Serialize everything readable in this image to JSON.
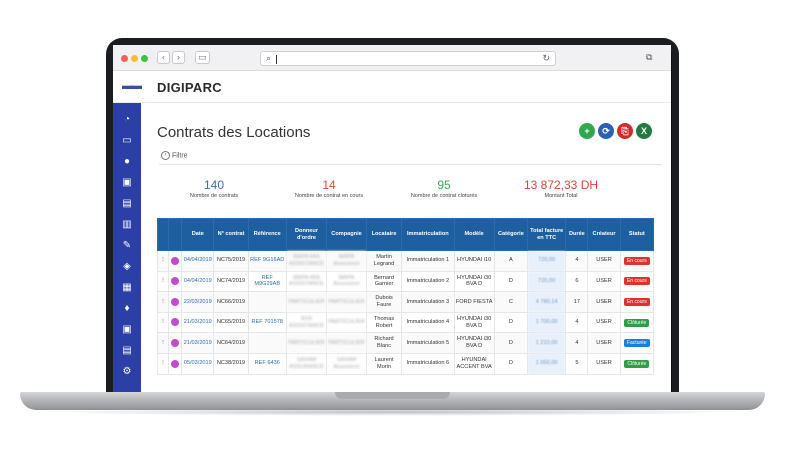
{
  "app": {
    "brand": "DIGIPARC"
  },
  "page": {
    "title": "Contrats des Locations",
    "filter_label": "Filtre"
  },
  "actions": [
    {
      "name": "add",
      "glyph": "+",
      "color": "#2fa84f"
    },
    {
      "name": "refresh",
      "glyph": "⟳",
      "color": "#2b5fb8"
    },
    {
      "name": "pdf",
      "glyph": "⎘",
      "color": "#d42a2a"
    },
    {
      "name": "excel",
      "glyph": "X",
      "color": "#1f7a43"
    }
  ],
  "stats": [
    {
      "value": "140",
      "label": "Nombre de contrats",
      "color": "#3b6fb8"
    },
    {
      "value": "14",
      "label": "Nombre de contrat en cours",
      "color": "#e0463a"
    },
    {
      "value": "95",
      "label": "Nombre de contrat cloturés",
      "color": "#36a852"
    },
    {
      "value": "13 872,33 DH",
      "label": "Montant Total",
      "color": "#e0463a"
    }
  ],
  "table": {
    "headers": [
      "",
      "",
      "Date",
      "N° contrat",
      "Référence",
      "Donneur d'ordre",
      "Compagnie",
      "Locataire",
      "Immatriculation",
      "Modèle",
      "Catégorie",
      "Total facture en TTC",
      "Durée",
      "Créateur",
      "Statut"
    ],
    "rows": [
      {
        "date": "04/04/2019",
        "num": "NC75/2019",
        "ref": "REF 9G16AD",
        "donneur": "MAPA MIA ASSISTANCE",
        "compagnie": "MAPA Assurance",
        "locataire": "Martin Legrand",
        "immat": "Immatriculation 1",
        "modele": "HYUNDAI i10",
        "cat": "A",
        "total": "720,00",
        "duree": "4",
        "createur": "USER",
        "statut": "En cours",
        "statut_color": "#e03131"
      },
      {
        "date": "04/04/2019",
        "num": "NC74/2019",
        "ref": "REF M9G29AB",
        "donneur": "MAPA MIA ASSISTANCE",
        "compagnie": "MAPA Assurance",
        "locataire": "Bernard Garnier",
        "immat": "Immatriculation 2",
        "modele": "HYUNDAI i30 BVA D",
        "cat": "D",
        "total": "720,00",
        "duree": "6",
        "createur": "USER",
        "statut": "En cours",
        "statut_color": "#e03131"
      },
      {
        "date": "22/03/2019",
        "num": "NC66/2019",
        "ref": "",
        "donneur": "PARTICULIER",
        "compagnie": "PARTICULIER",
        "locataire": "Dubois Faure",
        "immat": "Immatriculation 3",
        "modele": "FORD FIESTA",
        "cat": "C",
        "total": "4 780,14",
        "duree": "17",
        "createur": "USER",
        "statut": "En cours",
        "statut_color": "#e03131"
      },
      {
        "date": "21/03/2019",
        "num": "NC65/2019",
        "ref": "REF 701578",
        "donneur": "AXA ASSISTANCE",
        "compagnie": "PARTICULIER",
        "locataire": "Thomas Robert",
        "immat": "Immatriculation 4",
        "modele": "HYUNDAI i30 BVA D",
        "cat": "D",
        "total": "1 700,00",
        "duree": "4",
        "createur": "USER",
        "statut": "Clôturée",
        "statut_color": "#2f9e44"
      },
      {
        "date": "21/03/2019",
        "num": "NC64/2019",
        "ref": "",
        "donneur": "PARTICULIER",
        "compagnie": "PARTICULIER",
        "locataire": "Richard Blanc",
        "immat": "Immatriculation 5",
        "modele": "HYUNDAI i30 BVA D",
        "cat": "D",
        "total": "1 210,00",
        "duree": "4",
        "createur": "USER",
        "statut": "Facturée",
        "statut_color": "#1c7ed6"
      },
      {
        "date": "05/03/2019",
        "num": "NC38/2019",
        "ref": "REF 6436",
        "donneur": "SAHAM ASSURANCE",
        "compagnie": "SAHAM Assurance",
        "locataire": "Laurent Morin",
        "immat": "Immatriculation 6",
        "modele": "HYUNDAI ACCENT BVA",
        "cat": "D",
        "total": "1 050,00",
        "duree": "5",
        "createur": "USER",
        "statut": "Clôturée",
        "statut_color": "#2f9e44"
      }
    ]
  },
  "sidebar": {
    "icons": [
      "dashboard-icon",
      "car-icon",
      "user-icon",
      "vehicle-front-icon",
      "document-icon",
      "fuel-icon",
      "wrench-icon",
      "layers-icon",
      "building-icon",
      "map-pin-icon",
      "bus-icon",
      "notes-icon",
      "gear-icon"
    ]
  }
}
